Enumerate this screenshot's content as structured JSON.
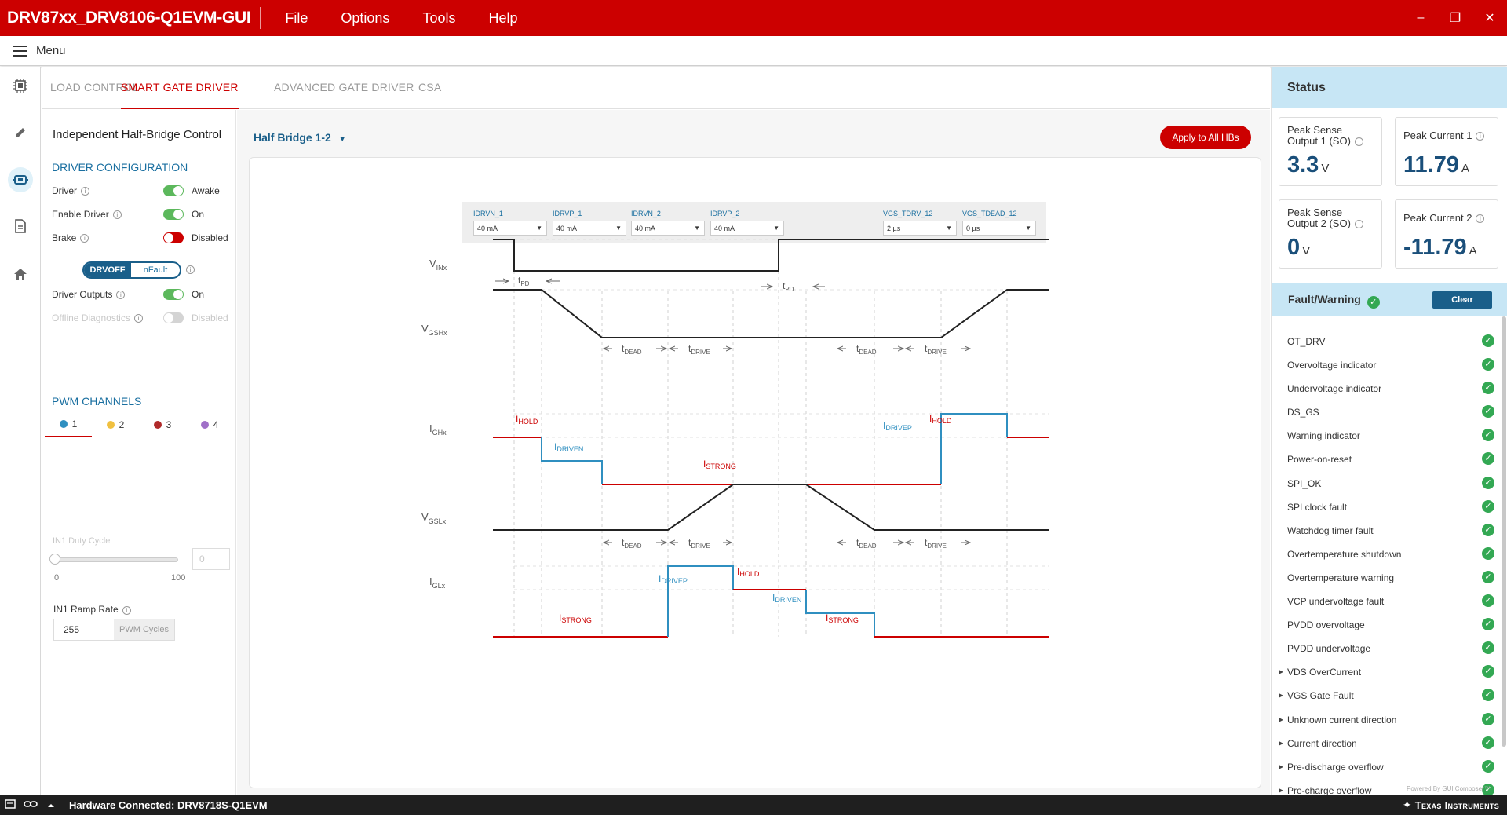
{
  "titlebar": {
    "app_title": "DRV87xx_DRV8106-Q1EVM-GUI",
    "menus": [
      "File",
      "Options",
      "Tools",
      "Help"
    ],
    "min": "–",
    "restore": "❐",
    "close": "✕"
  },
  "menubar": {
    "label": "Menu"
  },
  "tabs": [
    "LOAD CONTROL",
    "SMART GATE DRIVER",
    "ADVANCED GATE DRIVER",
    "CSA"
  ],
  "left": {
    "title": "Independent Half-Bridge Control",
    "driver_config": "DRIVER CONFIGURATION",
    "rows": [
      {
        "label": "Driver",
        "value": "Awake"
      },
      {
        "label": "Enable Driver",
        "value": "On"
      },
      {
        "label": "Brake",
        "value": "Disabled"
      }
    ],
    "seg_on": "DRVOFF",
    "seg_off": "nFault",
    "driver_outputs": {
      "label": "Driver Outputs",
      "value": "On"
    },
    "offline_diag": {
      "label": "Offline Diagnostics",
      "value": "Disabled"
    },
    "pwm_channels": "PWM CHANNELS",
    "pwm": [
      "1",
      "2",
      "3",
      "4"
    ],
    "duty_label": "IN1 Duty Cycle",
    "duty_min": "0",
    "duty_max": "100",
    "duty_value": "0",
    "ramp_label": "IN1 Ramp Rate",
    "ramp_value": "255",
    "ramp_unit": "PWM Cycles",
    "info": "i"
  },
  "main": {
    "hb_select": "Half Bridge 1-2",
    "hb_arrow": "▼",
    "apply": "Apply to All HBs",
    "params": [
      {
        "label": "IDRVN_1",
        "value": "40 mA"
      },
      {
        "label": "IDRVP_1",
        "value": "40 mA"
      },
      {
        "label": "IDRVN_2",
        "value": "40 mA"
      },
      {
        "label": "IDRVP_2",
        "value": "40 mA"
      },
      {
        "label": "VGS_TDRV_12",
        "value": "2 µs"
      },
      {
        "label": "VGS_TDEAD_12",
        "value": "0 µs"
      }
    ]
  },
  "diagram": {
    "V": "V",
    "I": "I",
    "t": "t",
    "INx": "INx",
    "GSHx": "GSHx",
    "GHx": "GHx",
    "GSLx": "GSLx",
    "GLx": "GLx",
    "PD": "PD",
    "DEAD": "DEAD",
    "DRIVE": "DRIVE",
    "HOLD": "HOLD",
    "DRIVEN": "DRIVEN",
    "DRIVEP": "DRIVEP",
    "STRONG": "STRONG"
  },
  "status": {
    "title": "Status",
    "cards": [
      {
        "label1": "Peak Sense",
        "label2": "Output 1 (SO)",
        "value": "3.3",
        "unit": "V"
      },
      {
        "label1": "Peak Current 1",
        "label2": "",
        "value": "11.79",
        "unit": "A"
      },
      {
        "label1": "Peak Sense",
        "label2": "Output 2 (SO)",
        "value": "0",
        "unit": "V"
      },
      {
        "label1": "Peak Current 2",
        "label2": "",
        "value": "-11.79",
        "unit": "A"
      }
    ],
    "fault_title": "Fault/Warning",
    "clear": "Clear",
    "check": "✓",
    "faults": [
      {
        "label": "OT_DRV",
        "expandable": false
      },
      {
        "label": "Overvoltage indicator",
        "expandable": false
      },
      {
        "label": "Undervoltage indicator",
        "expandable": false
      },
      {
        "label": "DS_GS",
        "expandable": false
      },
      {
        "label": "Warning indicator",
        "expandable": false
      },
      {
        "label": "Power-on-reset",
        "expandable": false
      },
      {
        "label": "SPI_OK",
        "expandable": false
      },
      {
        "label": "SPI clock fault",
        "expandable": false
      },
      {
        "label": "Watchdog timer fault",
        "expandable": false
      },
      {
        "label": "Overtemperature shutdown",
        "expandable": false
      },
      {
        "label": "Overtemperature warning",
        "expandable": false
      },
      {
        "label": "VCP undervoltage fault",
        "expandable": false
      },
      {
        "label": "PVDD overvoltage",
        "expandable": false
      },
      {
        "label": "PVDD undervoltage",
        "expandable": false
      },
      {
        "label": "VDS OverCurrent",
        "expandable": true
      },
      {
        "label": "VGS Gate Fault",
        "expandable": true
      },
      {
        "label": "Unknown current direction",
        "expandable": true
      },
      {
        "label": "Current direction",
        "expandable": true
      },
      {
        "label": "Pre-discharge overflow",
        "expandable": true
      },
      {
        "label": "Pre-charge overflow",
        "expandable": true
      }
    ],
    "powered": "Powered By GUI Composer™"
  },
  "bottom": {
    "hardware": "Hardware Connected: DRV8718S-Q1EVM",
    "ti": "Texas Instruments"
  },
  "colors": {
    "accent": "#cc0000",
    "blue": "#2f8fc0",
    "status_bg": "#c7e6f5"
  }
}
